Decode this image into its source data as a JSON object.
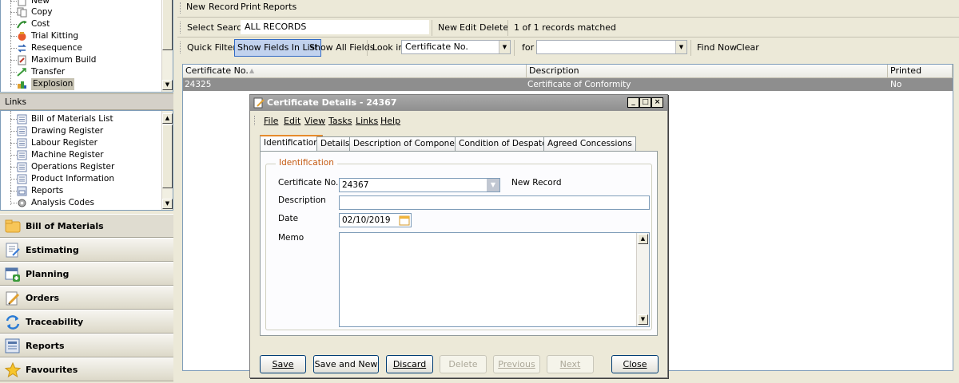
{
  "sidebar": {
    "top_tree": [
      {
        "label": "New",
        "icon": "new-icon"
      },
      {
        "label": "Copy",
        "icon": "copy-icon"
      },
      {
        "label": "Cost",
        "icon": "cost-icon"
      },
      {
        "label": "Trial Kitting",
        "icon": "trial-kitting-icon"
      },
      {
        "label": "Resequence",
        "icon": "resequence-icon"
      },
      {
        "label": "Maximum Build",
        "icon": "maximum-build-icon"
      },
      {
        "label": "Transfer",
        "icon": "transfer-icon"
      },
      {
        "label": "Explosion",
        "icon": "explosion-icon"
      }
    ],
    "links_header": "Links",
    "links_tree": [
      {
        "label": "Bill of Materials List",
        "icon": "document-icon"
      },
      {
        "label": "Drawing Register",
        "icon": "document-icon"
      },
      {
        "label": "Labour Register",
        "icon": "document-icon"
      },
      {
        "label": "Machine Register",
        "icon": "document-icon"
      },
      {
        "label": "Operations Register",
        "icon": "document-icon"
      },
      {
        "label": "Product Information",
        "icon": "document-icon"
      },
      {
        "label": "Reports",
        "icon": "reports-icon"
      },
      {
        "label": "Analysis Codes",
        "icon": "gear-icon"
      }
    ],
    "nav": [
      {
        "label": "Bill of Materials",
        "icon": "folder-icon"
      },
      {
        "label": "Estimating",
        "icon": "estimating-icon"
      },
      {
        "label": "Planning",
        "icon": "planning-icon"
      },
      {
        "label": "Orders",
        "icon": "orders-icon"
      },
      {
        "label": "Traceability",
        "icon": "traceability-icon"
      },
      {
        "label": "Reports",
        "icon": "reports-icon"
      },
      {
        "label": "Favourites",
        "icon": "star-icon"
      }
    ]
  },
  "toolbar1": {
    "new": "New",
    "record": "Record",
    "print": "Print",
    "reports": "Reports"
  },
  "toolbar2": {
    "select_search_label": "Select Search",
    "select_search_value": "ALL RECORDS",
    "new": "New",
    "edit": "Edit",
    "delete": "Delete",
    "matched": "1 of 1 records matched"
  },
  "toolbar3": {
    "quick_filter": "Quick Filter",
    "show_fields": "Show Fields In List",
    "show_all": "Show All Fields",
    "look_in_label": "Look in",
    "look_in_value": "Certificate No.",
    "for_label": "for",
    "for_value": "",
    "find_now": "Find Now",
    "clear": "Clear"
  },
  "grid": {
    "columns": [
      "Certificate No.",
      "Description",
      "Printed"
    ],
    "rows": [
      {
        "certificate_no": "24325",
        "description": "Certificate of Conformity",
        "printed": "No"
      }
    ]
  },
  "dialog": {
    "title": "Certificate Details - 24367",
    "menu": [
      "File",
      "Edit",
      "View",
      "Tasks",
      "Links",
      "Help"
    ],
    "tabs": [
      "Identification",
      "Details",
      "Description of Components",
      "Condition of Despatch",
      "Agreed Concessions"
    ],
    "group_label": "Identification",
    "fields": {
      "certificate_no_label": "Certificate No.",
      "certificate_no_value": "24367",
      "status": "New Record",
      "description_label": "Description",
      "description_value": "",
      "date_label": "Date",
      "date_value": "02/10/2019",
      "memo_label": "Memo",
      "memo_value": ""
    },
    "buttons": {
      "save": "Save",
      "save_and_new": "Save and New",
      "discard": "Discard",
      "delete": "Delete",
      "previous": "Previous",
      "next": "Next",
      "close": "Close"
    }
  }
}
